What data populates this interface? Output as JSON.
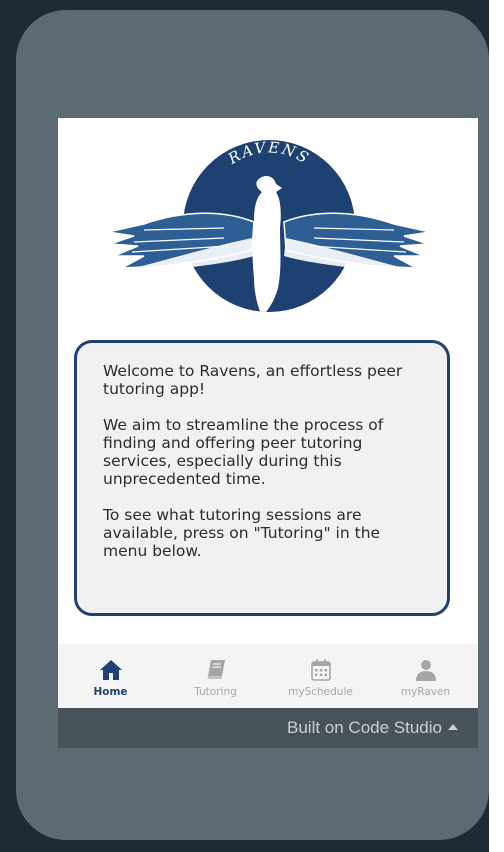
{
  "logo": {
    "text": "RAVENS",
    "colors": {
      "circle": "#1d4170",
      "wings": "#2e5f94",
      "body": "#ffffff"
    }
  },
  "welcome": {
    "paragraphs": [
      "Welcome to Ravens, an effortless peer tutoring app!",
      "We aim to streamline the process of finding and offering peer tutoring services, especially during this unprecedented time.",
      "To see what tutoring sessions are available, press on \"Tutoring\" in the menu below."
    ]
  },
  "tabs": [
    {
      "label": "Home",
      "icon": "home-icon",
      "active": true
    },
    {
      "label": "Tutoring",
      "icon": "book-icon",
      "active": false
    },
    {
      "label": "mySchedule",
      "icon": "calendar-icon",
      "active": false
    },
    {
      "label": "myRaven",
      "icon": "user-icon",
      "active": false
    }
  ],
  "footer": {
    "label": "Built on Code Studio"
  },
  "colors": {
    "accent": "#1d4170",
    "inactive": "#a6a6a6",
    "phone_frame": "#5c6b72",
    "background": "#1f2a33"
  }
}
